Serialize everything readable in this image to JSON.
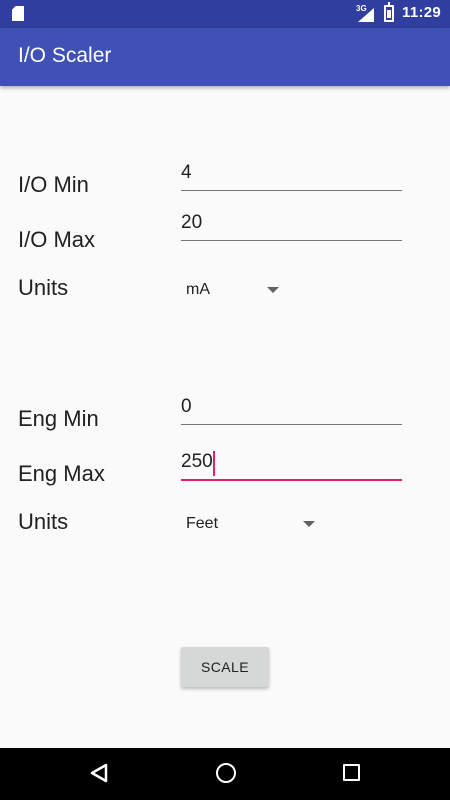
{
  "status_bar": {
    "sd_icon": "sd-card-icon",
    "network_type": "3G",
    "signal_icon": "signal-icon",
    "battery_icon": "battery-charging-icon",
    "time": "11:29"
  },
  "app_bar": {
    "title": "I/O Scaler"
  },
  "io": {
    "min_label": "I/O Min",
    "min_value": "4",
    "max_label": "I/O Max",
    "max_value": "20",
    "units_label": "Units",
    "units_selected": "mA"
  },
  "eng": {
    "min_label": "Eng Min",
    "min_value": "0",
    "max_label": "Eng Max",
    "max_value": "250",
    "units_label": "Units",
    "units_selected": "Feet"
  },
  "scale_button": {
    "label": "SCALE"
  },
  "nav_bar": {
    "back_icon": "back-icon",
    "home_icon": "home-icon",
    "recents_icon": "recents-icon"
  },
  "colors": {
    "status_bar": "#303f9f",
    "app_bar": "#3f51b5",
    "accent": "#e91e63",
    "background": "#fafafa"
  }
}
